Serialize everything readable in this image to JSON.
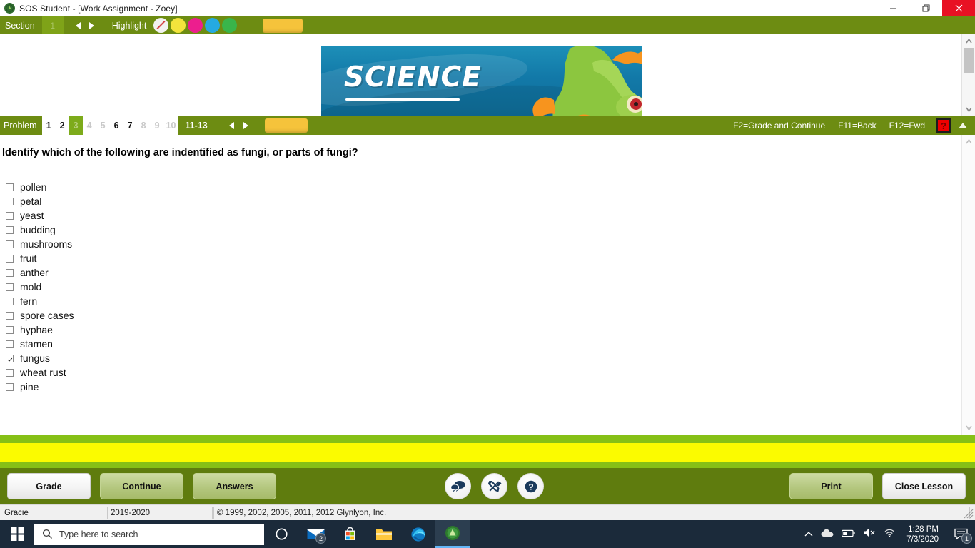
{
  "window": {
    "title": "SOS Student - [Work Assignment - Zoey]",
    "app_icon": "sos-app-icon",
    "minimize_label": "minimize-icon",
    "restore_label": "restore-icon",
    "close_label": "close-icon"
  },
  "section_bar": {
    "section_label": "Section",
    "section_number": "1",
    "prev_icon": "prev-arrow-icon",
    "next_icon": "next-arrow-icon",
    "highlight_label": "Highlight",
    "highlight_colors": [
      "none",
      "#f2e33c",
      "#ec1e8e",
      "#25aae1",
      "#39b54a"
    ],
    "note_button": "sticky-note-button"
  },
  "banner": {
    "subject": "SCIENCE",
    "bg_color": "#1279a8",
    "frog_color": "#8cc63f"
  },
  "problem_bar": {
    "problem_label": "Problem",
    "numbers": [
      {
        "label": "1",
        "state": "normal"
      },
      {
        "label": "2",
        "state": "normal"
      },
      {
        "label": "3",
        "state": "active"
      },
      {
        "label": "4",
        "state": "dim"
      },
      {
        "label": "5",
        "state": "dim"
      },
      {
        "label": "6",
        "state": "normal"
      },
      {
        "label": "7",
        "state": "normal"
      },
      {
        "label": "8",
        "state": "dim"
      },
      {
        "label": "9",
        "state": "dim"
      },
      {
        "label": "10",
        "state": "dim"
      }
    ],
    "range_label": "11-13",
    "prev_icon": "prev-arrow-icon",
    "next_icon": "next-arrow-icon",
    "note_button": "sticky-note-button",
    "fkeys": [
      "F2=Grade and Continue",
      "F11=Back",
      "F12=Fwd"
    ],
    "help_label": "?",
    "collapse_icon": "collapse-triangle-icon"
  },
  "content": {
    "question": "Identify which of the following are indentified as fungi, or parts of fungi?",
    "choices": [
      {
        "label": "pollen",
        "checked": false
      },
      {
        "label": "petal",
        "checked": false
      },
      {
        "label": "yeast",
        "checked": false
      },
      {
        "label": "budding",
        "checked": false
      },
      {
        "label": "mushrooms",
        "checked": false
      },
      {
        "label": "fruit",
        "checked": false
      },
      {
        "label": "anther",
        "checked": false
      },
      {
        "label": "mold",
        "checked": false
      },
      {
        "label": "fern",
        "checked": false
      },
      {
        "label": "spore cases",
        "checked": false
      },
      {
        "label": "hyphae",
        "checked": false
      },
      {
        "label": "stamen",
        "checked": false
      },
      {
        "label": "fungus",
        "checked": true
      },
      {
        "label": "wheat rust",
        "checked": false
      },
      {
        "label": "pine",
        "checked": false
      }
    ]
  },
  "buttons": {
    "grade": "Grade",
    "continue": "Continue",
    "answers": "Answers",
    "print": "Print",
    "close_lesson": "Close Lesson",
    "chat_icon": "chat-bubbles-icon",
    "tools_icon": "tools-icon",
    "help_icon": "help-question-icon"
  },
  "status_bar": {
    "user": "Gracie",
    "school_year": "2019-2020",
    "copyright": "© 1999, 2002, 2005, 2011, 2012 Glynlyon, Inc."
  },
  "taskbar": {
    "start_icon": "windows-start-icon",
    "search_placeholder": "Type here to search",
    "search_icon": "search-icon",
    "cortana_icon": "cortana-icon",
    "mail_icon": "mail-icon",
    "mail_badge": "2",
    "store_icon": "microsoft-store-icon",
    "explorer_icon": "file-explorer-icon",
    "edge_icon": "edge-browser-icon",
    "sos_icon": "sos-app-icon",
    "tray": {
      "expand_icon": "chevron-up-icon",
      "onedrive_icon": "onedrive-cloud-icon",
      "battery_icon": "battery-icon",
      "volume_icon": "volume-muted-icon",
      "wifi_icon": "wifi-icon",
      "time": "1:28 PM",
      "date": "7/3/2020",
      "notification_icon": "notification-icon",
      "notification_badge": "1"
    }
  }
}
